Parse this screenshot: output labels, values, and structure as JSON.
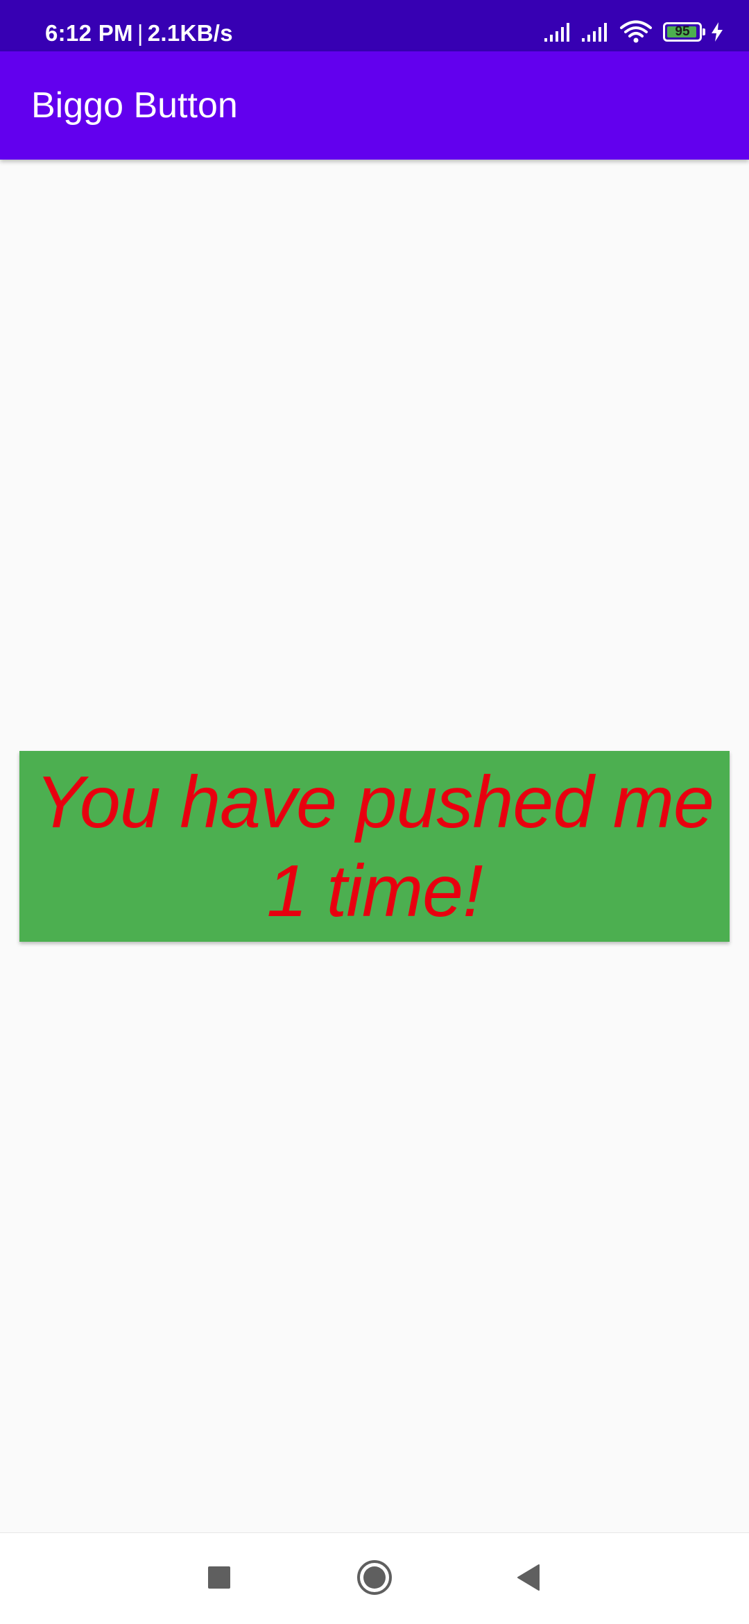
{
  "status_bar": {
    "time": "6:12 PM",
    "separator": "|",
    "speed": "2.1KB/s",
    "battery_level": "95",
    "icons": [
      "signal-icon",
      "signal-icon",
      "wifi-icon",
      "battery-icon",
      "charging-bolt-icon"
    ]
  },
  "app_bar": {
    "title": "Biggo Button"
  },
  "main": {
    "button_label": "You have pushed me 1 time!"
  },
  "nav_bar": {
    "icons": [
      "recents-square-icon",
      "home-circle-icon",
      "back-triangle-icon"
    ]
  },
  "colors": {
    "status_bar": "#3700b3",
    "app_bar": "#6200ee",
    "button_background": "#4caf50",
    "button_text": "#e8000f",
    "background": "#fafafa"
  }
}
